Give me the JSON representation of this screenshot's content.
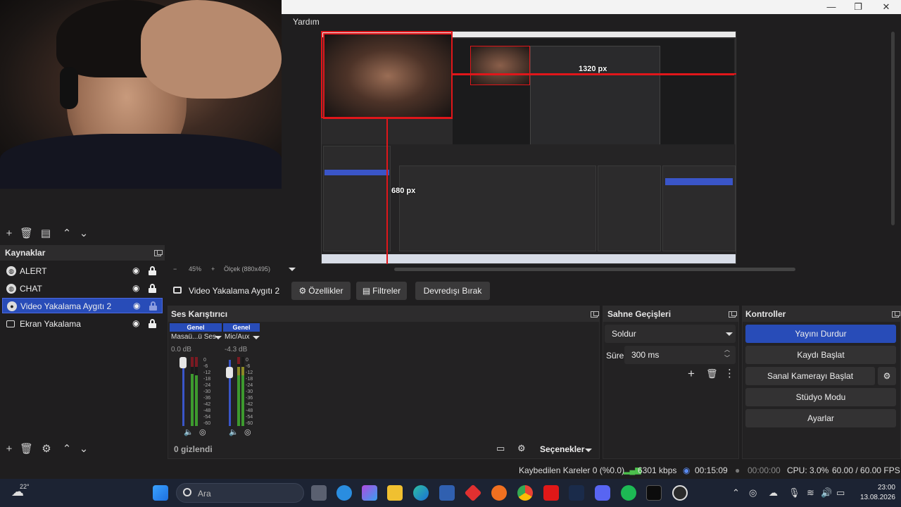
{
  "window": {
    "menu": [
      "Yardım"
    ]
  },
  "preview": {
    "label_width": "1320 px",
    "label_height": "680 px",
    "zoom": "45%",
    "canvas_size": "Ölçek (880x495)"
  },
  "sources": {
    "title": "Kaynaklar",
    "items": [
      {
        "label": "ALERT",
        "icon": "globe-icon",
        "selected": false
      },
      {
        "label": "CHAT",
        "icon": "globe-icon",
        "selected": false
      },
      {
        "label": "Video Yakalama Aygıtı 2",
        "icon": "camera-icon",
        "selected": true
      },
      {
        "label": "Ekran Yakalama",
        "icon": "monitor-icon",
        "selected": false
      }
    ]
  },
  "properties_bar": {
    "source_name": "Video Yakalama Aygıtı 2",
    "properties": "Özellikler",
    "filters": "Filtreler",
    "deactivate": "Devredışı Bırak"
  },
  "mixer": {
    "title": "Ses Karıştırıcı",
    "channels": [
      {
        "tag": "Genel",
        "name": "Masaü...ü Ses",
        "db": "0.0 dB",
        "level": 0.62
      },
      {
        "tag": "Genel",
        "name": "Mic/Aux",
        "db": "-4.3 dB",
        "level": 0.78
      }
    ],
    "scale": [
      "0",
      "-6",
      "-12",
      "-18",
      "-24",
      "-30",
      "-36",
      "-42",
      "-48",
      "-54",
      "-60"
    ],
    "hidden": "0 gizlendi",
    "options": "Seçenekler"
  },
  "transitions": {
    "title": "Sahne Geçişleri",
    "selected": "Soldur",
    "duration_label": "Süre",
    "duration_value": "300 ms"
  },
  "controls": {
    "title": "Kontroller",
    "stop_stream": "Yayını Durdur",
    "start_recording": "Kaydı Başlat",
    "start_virtual_cam": "Sanal Kamerayı Başlat",
    "studio_mode": "Stüdyo Modu",
    "settings": "Ayarlar"
  },
  "status": {
    "dropped": "Kaybedilen Kareler 0 (%0.0)",
    "bitrate": "6301 kbps",
    "live_time": "00:15:09",
    "rec_time": "00:00:00",
    "cpu": "CPU: 3.0%",
    "fps": "60.00 / 60.00 FPS"
  },
  "taskbar": {
    "weather": "22°",
    "search_placeholder": "Ara",
    "time": "23:00",
    "date": "13.08.2026"
  },
  "colors": {
    "accent": "#284cb8",
    "selection_red": "#e0161a",
    "panel": "#232223",
    "background": "#1f1e1f"
  }
}
